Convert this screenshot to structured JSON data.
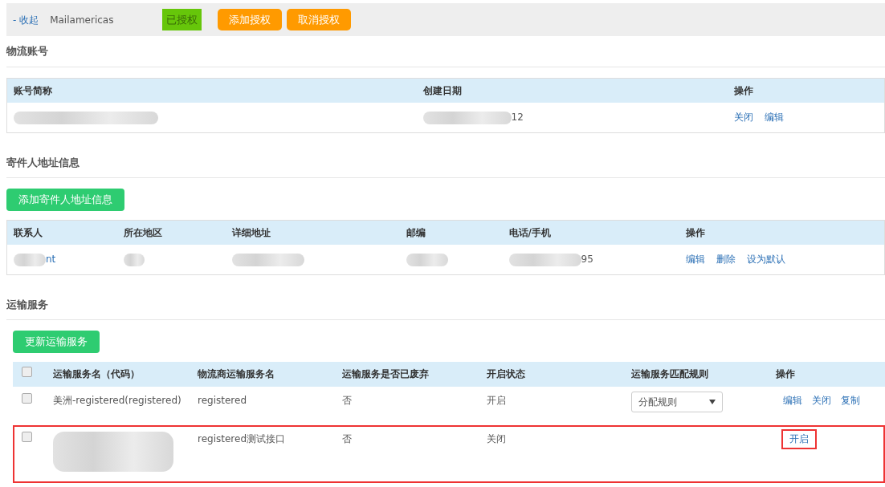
{
  "header": {
    "collapse_link": "- 收起",
    "carrier": "Mailamericas",
    "status_badge": "已授权",
    "buttons": [
      "添加授权",
      "取消授权"
    ]
  },
  "accounts": {
    "title": "物流账号",
    "columns": [
      "账号简称",
      "创建日期",
      "操作"
    ],
    "rows": [
      {
        "cells": [
          {
            "redacted": true
          },
          {
            "text": "12",
            "redacted": true
          }
        ],
        "actions": [
          "关闭",
          "编辑"
        ]
      }
    ]
  },
  "senders": {
    "title": "寄件人地址信息",
    "add_button": "添加寄件人地址信息",
    "columns": [
      "联系人",
      "所在地区",
      "详细地址",
      "邮编",
      "电话/手机",
      "操作"
    ],
    "rows": [
      {
        "cells": [
          {
            "text": "nt",
            "redacted": true,
            "link": true
          },
          {
            "redacted": true
          },
          {
            "redacted": true
          },
          {
            "redacted": true
          },
          {
            "text": "95",
            "redacted": true
          }
        ],
        "actions": [
          "编辑",
          "删除",
          "设为默认"
        ]
      }
    ]
  },
  "services": {
    "title": "运输服务",
    "update_button": "更新运输服务",
    "select_all_checked": false,
    "columns": [
      "运输服务名（代码）",
      "物流商运输服务名",
      "运输服务是否已废弃",
      "开启状态",
      "运输服务匹配规则",
      "操作"
    ],
    "rows": [
      {
        "checked": false,
        "highlighted": false,
        "name": {
          "text": "美洲-registered(registered)",
          "redacted": false
        },
        "carrier_service": "registered",
        "deprecated": "否",
        "status": "开启",
        "rule": "分配规则",
        "actions": [
          {
            "label": "编辑",
            "highlighted": false
          },
          {
            "label": "关闭",
            "highlighted": false
          },
          {
            "label": "复制",
            "highlighted": false
          }
        ]
      },
      {
        "checked": false,
        "highlighted": true,
        "name": {
          "redacted": true
        },
        "carrier_service": "registered测试接口",
        "deprecated": "否",
        "status": "关闭",
        "actions": [
          {
            "label": "开启",
            "highlighted": true
          }
        ]
      }
    ]
  }
}
